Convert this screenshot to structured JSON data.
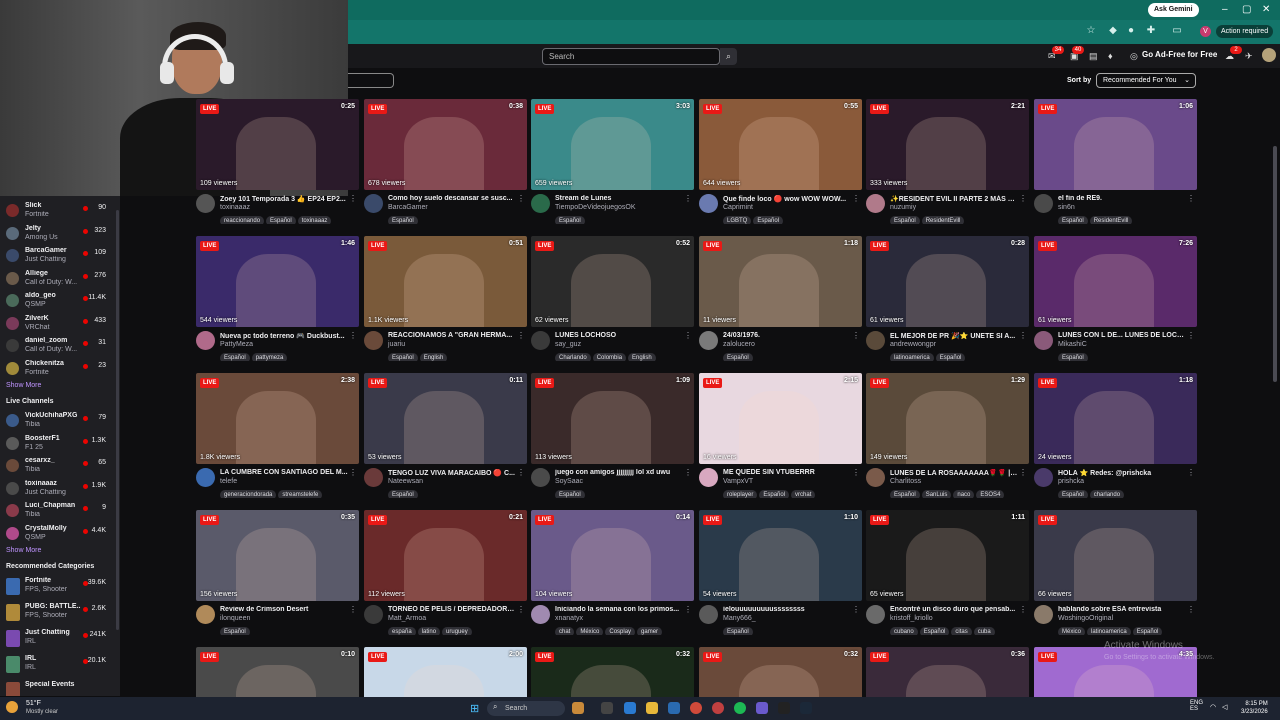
{
  "browser": {
    "ask_gemini": "Ask Gemini",
    "action_required": "Action required",
    "profile_initial": "V"
  },
  "header": {
    "search_placeholder": "Search",
    "badges": [
      "34",
      "40",
      "2"
    ],
    "ad_free": "Go Ad-Free for Free"
  },
  "sort": {
    "label": "Sort by",
    "value": "Recommended For You"
  },
  "sidebar": {
    "followed": [
      {
        "name": "Slick",
        "game": "Fortnite",
        "viewers": "90",
        "color": "#7a2a2a"
      },
      {
        "name": "Jelty",
        "game": "Among Us",
        "viewers": "323",
        "color": "#5a6a7a"
      },
      {
        "name": "BarcaGamer",
        "game": "Just Chatting",
        "viewers": "109",
        "color": "#3a4a6a"
      },
      {
        "name": "Alliege",
        "game": "Call of Duty: W...",
        "viewers": "276",
        "color": "#6a5a4a"
      },
      {
        "name": "aldo_geo",
        "game": "QSMP",
        "viewers": "11.4K",
        "color": "#4a6a5a"
      },
      {
        "name": "ZilverK",
        "game": "VRChat",
        "viewers": "433",
        "color": "#7a3a5a"
      },
      {
        "name": "daniel_zoom",
        "game": "Call of Duty: W...",
        "viewers": "31",
        "color": "#3a3a3a"
      },
      {
        "name": "Chickenitza",
        "game": "Fortnite",
        "viewers": "23",
        "color": "#a08a3a"
      }
    ],
    "show_more": "Show More",
    "live_channels_title": "Live Channels",
    "live_channels": [
      {
        "name": "VickUchihaPXG",
        "game": "Tibia",
        "viewers": "79",
        "color": "#3a5a8a"
      },
      {
        "name": "BoosterF1",
        "game": "F1 25",
        "viewers": "1.3K",
        "color": "#5a5a5a"
      },
      {
        "name": "cesarxz_",
        "game": "Tibia",
        "viewers": "65",
        "color": "#6a4a3a"
      },
      {
        "name": "toxinaaaz",
        "game": "Just Chatting",
        "viewers": "1.9K",
        "color": "#4a4a4a"
      },
      {
        "name": "Luci_Chapman",
        "game": "Tibia",
        "viewers": "9",
        "color": "#8a3a4a"
      },
      {
        "name": "CrystalMolly",
        "game": "QSMP",
        "viewers": "4.4K",
        "color": "#b04a8a"
      }
    ],
    "show_more_2": "Show More",
    "categories_title": "Recommended Categories",
    "categories": [
      {
        "name": "Fortnite",
        "tags": "FPS, Shooter",
        "viewers": "39.6K",
        "color": "#3a6ab0"
      },
      {
        "name": "PUBG: BATTLE...",
        "tags": "FPS, Shooter",
        "viewers": "2.6K",
        "color": "#b08a3a"
      },
      {
        "name": "Just Chatting",
        "tags": "IRL",
        "viewers": "241K",
        "color": "#7a4ab0"
      },
      {
        "name": "IRL",
        "tags": "IRL",
        "viewers": "20.1K",
        "color": "#4a8a6a"
      },
      {
        "name": "Special Events",
        "tags": "",
        "viewers": "",
        "color": "#8a4a3a"
      }
    ]
  },
  "live_label": "LIVE",
  "streams": [
    {
      "duration": "0:25",
      "viewers": "109 viewers",
      "title": "Zoey 101 Temporada 3 👍 EP24 EP2...",
      "streamer": "toxinaaaz",
      "tags": [
        "reaccionando",
        "Español",
        "toxinaaaz"
      ],
      "thumb": "#2a1a2a",
      "avatar": "#555"
    },
    {
      "duration": "0:38",
      "viewers": "678 viewers",
      "title": "Como hoy suelo descansar se susc...",
      "streamer": "BarcaGamer",
      "tags": [
        "Español"
      ],
      "thumb": "#6a2a3a",
      "avatar": "#3a4a6a"
    },
    {
      "duration": "3:03",
      "viewers": "659 viewers",
      "title": "Stream de Lunes",
      "streamer": "TiempoDeVideojuegosOK",
      "tags": [
        "Español"
      ],
      "thumb": "#3a8a8a",
      "avatar": "#2a6a4a"
    },
    {
      "duration": "0:55",
      "viewers": "644 viewers",
      "title": "Que finde loco 🔴 wow WOW WOW...",
      "streamer": "Caprimint",
      "tags": [
        "LGBTQ",
        "Español"
      ],
      "thumb": "#8a5a3a",
      "avatar": "#6a7ab0"
    },
    {
      "duration": "2:21",
      "viewers": "333 viewers",
      "title": "✨RESIDENT EVIL II PARTE 2 MÁS E...",
      "streamer": "nuzumiy",
      "tags": [
        "Español",
        "ResidentEvill"
      ],
      "thumb": "#2a1a2a",
      "avatar": "#b07a8a"
    },
    {
      "duration": "1:06",
      "viewers": "",
      "title": "el fin de RE9.",
      "streamer": "sin6n",
      "tags": [
        "Español",
        "ResidentEvill"
      ],
      "thumb": "#6a4a8a",
      "avatar": "#4a4a4a"
    },
    {
      "duration": "1:46",
      "viewers": "544 viewers",
      "title": "Nueva pc todo terreno 🎮 Duckbust...",
      "streamer": "PattyMeza",
      "tags": [
        "Español",
        "pattymeza"
      ],
      "thumb": "#3a2a6a",
      "avatar": "#b06a8a"
    },
    {
      "duration": "0:51",
      "viewers": "1.1K viewers",
      "title": "REACCIONAMOS A \"GRAN HERMA...",
      "streamer": "juariu",
      "tags": [
        "Español",
        "English"
      ],
      "thumb": "#7a5a3a",
      "avatar": "#6a4a3a"
    },
    {
      "duration": "0:52",
      "viewers": "62 viewers",
      "title": "LUNES LOCHOSO",
      "streamer": "say_guz",
      "tags": [
        "Charlando",
        "Colombia",
        "English"
      ],
      "thumb": "#2a2a2a",
      "avatar": "#3a3a3a"
    },
    {
      "duration": "1:18",
      "viewers": "11 viewers",
      "title": "24/03/1976.",
      "streamer": "zalolucero",
      "tags": [
        "Español"
      ],
      "thumb": "#6a5a4a",
      "avatar": "#7a7a7a"
    },
    {
      "duration": "0:28",
      "viewers": "61 viewers",
      "title": "EL MEJOR DE PR 🎉⭐ UNETE SI A...",
      "streamer": "andrewwongpr",
      "tags": [
        "latinoamerica",
        "Español"
      ],
      "thumb": "#2a2a3a",
      "avatar": "#5a4a3a"
    },
    {
      "duration": "7:26",
      "viewers": "61 viewers",
      "title": "LUNES CON L DE... LUNES DE LOCU...",
      "streamer": "MikashiC",
      "tags": [
        "Español"
      ],
      "thumb": "#5a2a6a",
      "avatar": "#8a5a7a"
    },
    {
      "duration": "2:38",
      "viewers": "1.8K viewers",
      "title": "LA CUMBRE CON SANTIAGO DEL M...",
      "streamer": "telefe",
      "tags": [
        "generaciondorada",
        "streamstelefe"
      ],
      "thumb": "#6a4a3a",
      "avatar": "#3a6ab0"
    },
    {
      "duration": "0:11",
      "viewers": "53 viewers",
      "title": "TENGO LUZ VIVA MARACAIBO 🔴 C...",
      "streamer": "Nateewsan",
      "tags": [
        "Español"
      ],
      "thumb": "#3a3a4a",
      "avatar": "#6a3a3a"
    },
    {
      "duration": "1:09",
      "viewers": "113 viewers",
      "title": "juego con amigos jjjjjjjjj lol xd uwu",
      "streamer": "SoySaac",
      "tags": [
        "Español"
      ],
      "thumb": "#3a2a2a",
      "avatar": "#4a4a4a"
    },
    {
      "duration": "2:15",
      "viewers": "16 viewers",
      "title": "ME QUEDE SIN VTUBERRR",
      "streamer": "VampxVT",
      "tags": [
        "roleplayer",
        "Español",
        "vrchat"
      ],
      "thumb": "#e8d8e0",
      "avatar": "#d8a8c0"
    },
    {
      "duration": "1:29",
      "viewers": "149 viewers",
      "title": "LUNES DE LA ROSAAAAAAA🌹🌹 | ...",
      "streamer": "Charlitoss",
      "tags": [
        "Español",
        "SanLuis",
        "naco",
        "ESOS4"
      ],
      "thumb": "#5a4a3a",
      "avatar": "#7a5a4a"
    },
    {
      "duration": "1:18",
      "viewers": "24 viewers",
      "title": "HOLA ⭐ Redes: @prishcka",
      "streamer": "prishcka",
      "tags": [
        "Español",
        "charlando"
      ],
      "thumb": "#3a2a5a",
      "avatar": "#4a3a6a"
    },
    {
      "duration": "0:35",
      "viewers": "156 viewers",
      "title": "Review de Crimson Desert",
      "streamer": "ilonqueen",
      "tags": [
        "Español"
      ],
      "thumb": "#5a5a6a",
      "avatar": "#b08a5a"
    },
    {
      "duration": "0:21",
      "viewers": "112 viewers",
      "title": "TORNEO DE PELIS / DEPREDADOR l...",
      "streamer": "Matt_Armoa",
      "tags": [
        "españa",
        "latino",
        "uruguey"
      ],
      "thumb": "#6a2a2a",
      "avatar": "#3a3a3a"
    },
    {
      "duration": "0:14",
      "viewers": "104 viewers",
      "title": "Iniciando la semana con los primos...",
      "streamer": "xnanatyx",
      "tags": [
        "chat",
        "México",
        "Cosplay",
        "gamer"
      ],
      "thumb": "#6a5a8a",
      "avatar": "#a08ab0"
    },
    {
      "duration": "1:10",
      "viewers": "54 viewers",
      "title": "ielouuuuuuuuussssssss",
      "streamer": "Many666_",
      "tags": [
        "Español"
      ],
      "thumb": "#2a3a4a",
      "avatar": "#5a5a5a"
    },
    {
      "duration": "1:11",
      "viewers": "65 viewers",
      "title": "Encontré un disco duro que pensab...",
      "streamer": "kristoff_kriollo",
      "tags": [
        "cubano",
        "Español",
        "citas",
        "cuba"
      ],
      "thumb": "#1a1a1a",
      "avatar": "#6a6a6a"
    },
    {
      "duration": "",
      "viewers": "66 viewers",
      "title": "hablando sobre ESA entrevista",
      "streamer": "WoshingoOriginal",
      "tags": [
        "México",
        "latinoamerica",
        "Español"
      ],
      "thumb": "#3a3a4a",
      "avatar": "#8a7a6a"
    },
    {
      "duration": "0:10",
      "viewers": "",
      "title": "",
      "streamer": "",
      "tags": [],
      "thumb": "#4a4a4a",
      "avatar": "#4a4a4a"
    },
    {
      "duration": "2:00",
      "viewers": "",
      "title": "",
      "streamer": "",
      "tags": [],
      "thumb": "#c8d8e8",
      "avatar": "#4a4a4a"
    },
    {
      "duration": "0:32",
      "viewers": "",
      "title": "",
      "streamer": "",
      "tags": [],
      "thumb": "#1a2a1a",
      "avatar": "#4a4a4a"
    },
    {
      "duration": "0:32",
      "viewers": "",
      "title": "",
      "streamer": "",
      "tags": [],
      "thumb": "#6a4a3a",
      "avatar": "#4a4a4a"
    },
    {
      "duration": "0:36",
      "viewers": "",
      "title": "",
      "streamer": "",
      "tags": [],
      "thumb": "#3a2a3a",
      "avatar": "#4a4a4a"
    },
    {
      "duration": "4:35",
      "viewers": "",
      "title": "",
      "streamer": "",
      "tags": [],
      "thumb": "#a06ad0",
      "avatar": "#4a4a4a"
    }
  ],
  "watermark": {
    "title": "Activate Windows",
    "sub": "Go to Settings to activate Windows."
  },
  "taskbar": {
    "temp": "51°F",
    "weather": "Mostly clear",
    "search": "Search",
    "lang": "ENG",
    "region": "ES",
    "time": "8:15 PM",
    "date": "3/23/2026"
  }
}
